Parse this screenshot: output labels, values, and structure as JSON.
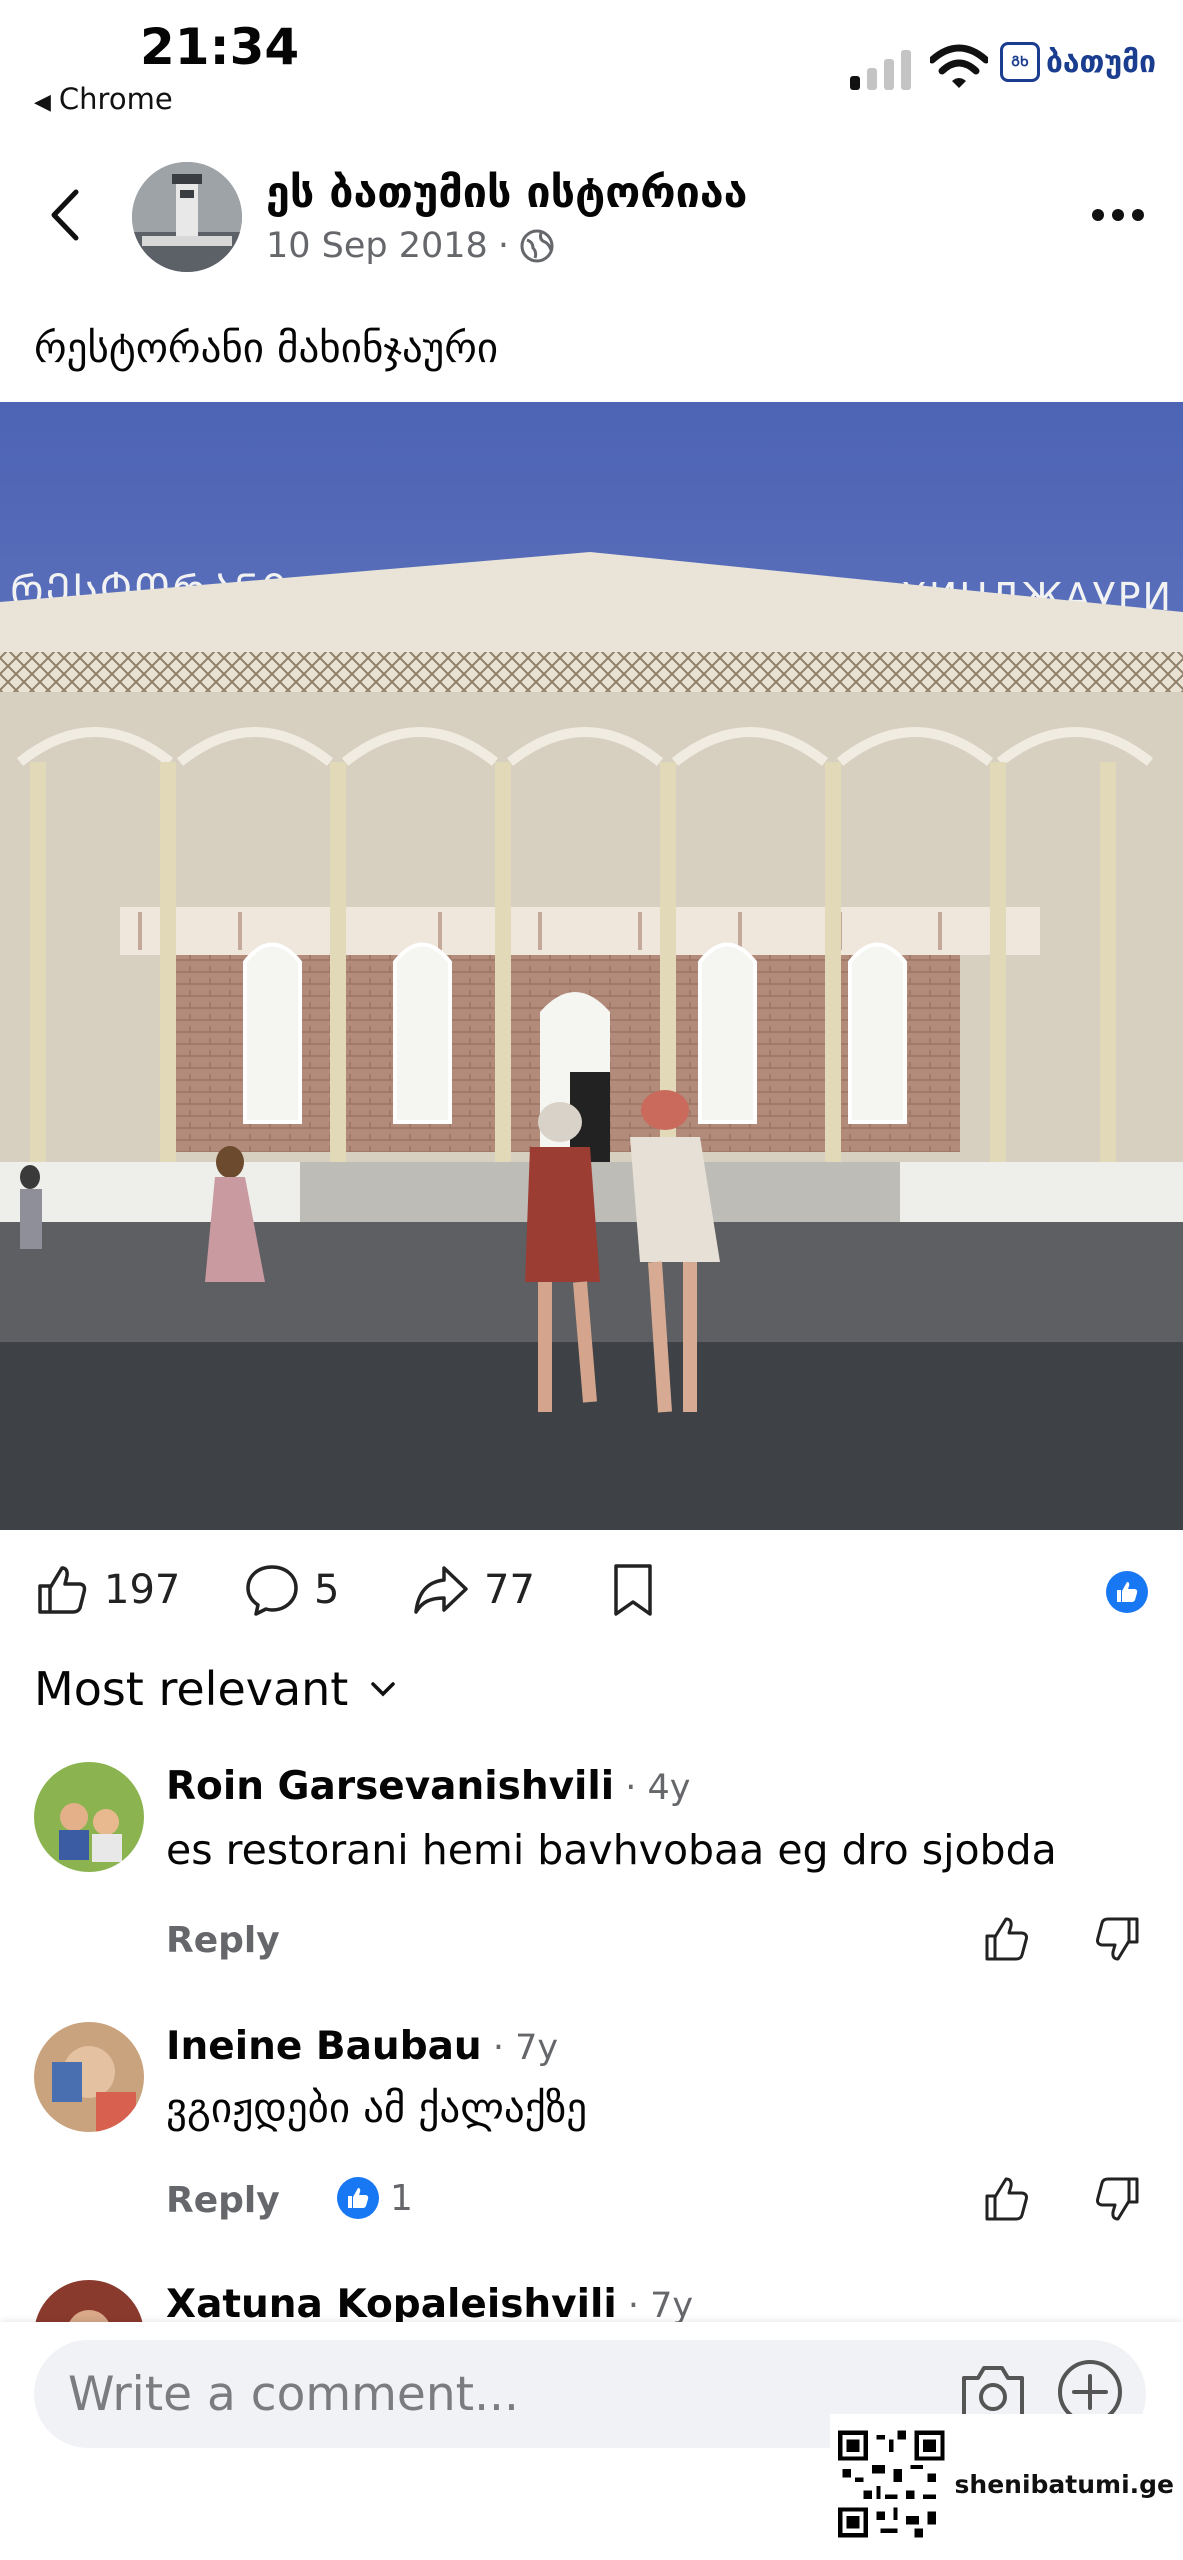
{
  "status_bar": {
    "time": "21:34",
    "back_app": "Chrome",
    "logo_text": "ბათუმი",
    "logo_box": "ᲒᲮ"
  },
  "post": {
    "page_name": "ეს ბათუმის ისტორიაა",
    "date": "10 Sep 2018",
    "meta_separator": "·",
    "text": "რესტორანი მახინჯაური",
    "likes": "197",
    "comments": "5",
    "shares": "77"
  },
  "comments_section": {
    "sort_label": "Most relevant",
    "comments": [
      {
        "author": "Roin Garsevanishvili",
        "age": " · 4y",
        "text": "es restorani hemi bavhvobaa eg dro sjobda",
        "reply": "Reply",
        "reaction_count": ""
      },
      {
        "author": "Ineine Baubau",
        "age": " · 7y",
        "text": "ვგიჟდები ამ ქალაქზე",
        "reply": "Reply",
        "reaction_count": "1"
      },
      {
        "author": "Xatuna Kopaleishvili",
        "age": " · 7y",
        "text": "",
        "reply": "",
        "reaction_count": ""
      }
    ]
  },
  "composer": {
    "placeholder": "Write a comment..."
  },
  "watermark": {
    "site": "shenibatumi.ge"
  },
  "colors": {
    "accent": "#1877f2",
    "muted": "#65676b",
    "input_bg": "#f0f2f5"
  }
}
